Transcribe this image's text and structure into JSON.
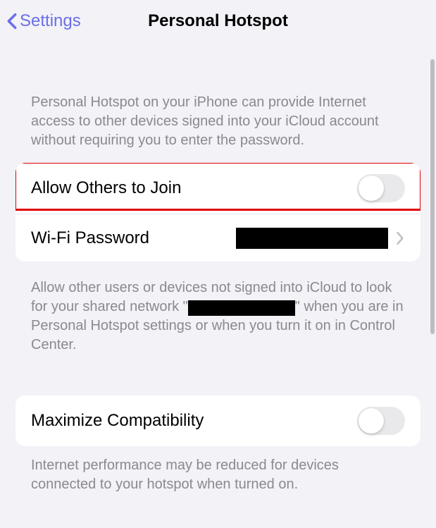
{
  "nav": {
    "back_label": "Settings",
    "title": "Personal Hotspot"
  },
  "section1": {
    "header": "Personal Hotspot on your iPhone can provide Internet access to other devices signed into your iCloud account without requiring you to enter the password.",
    "allow_others_label": "Allow Others to Join",
    "wifi_password_label": "Wi-Fi Password",
    "wifi_password_value": "",
    "footer_prefix": "Allow other users or devices not signed into iCloud to look for your shared network \"",
    "footer_suffix": "\" when you are in Personal Hotspot settings or when you turn it on in Control Center."
  },
  "section2": {
    "maximize_label": "Maximize Compatibility",
    "footer": "Internet performance may be reduced for devices connected to your hotspot when turned on."
  }
}
